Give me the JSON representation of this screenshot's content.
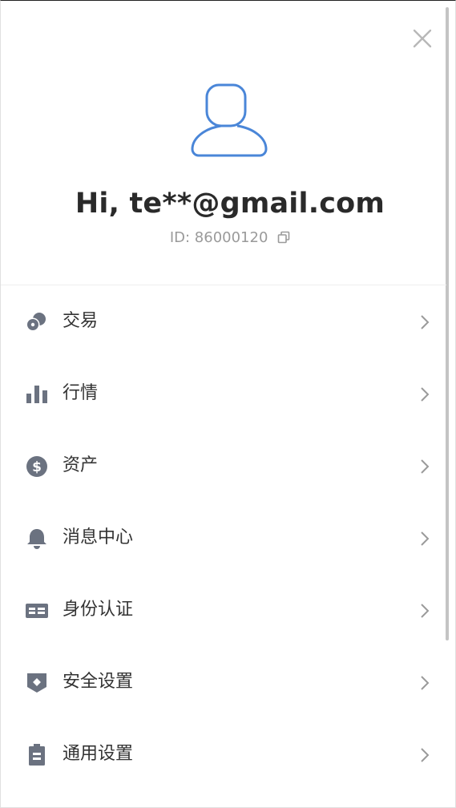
{
  "user": {
    "greeting": "Hi, te**@gmail.com",
    "id_text": "ID: 86000120"
  },
  "icons": {
    "close": "close-icon",
    "avatar": "user-avatar-icon",
    "copy": "copy-icon"
  },
  "colors": {
    "avatar_stroke": "#4a86d8",
    "icon_gray": "#6b7280",
    "chevron": "#9a9a9a",
    "text": "#333333"
  },
  "menu": {
    "items": [
      {
        "label": "交易",
        "icon": "coins-icon"
      },
      {
        "label": "行情",
        "icon": "bar-chart-icon"
      },
      {
        "label": "资产",
        "icon": "dollar-circle-icon"
      },
      {
        "label": "消息中心",
        "icon": "bell-icon"
      },
      {
        "label": "身份认证",
        "icon": "id-card-icon"
      },
      {
        "label": "安全设置",
        "icon": "shield-icon"
      },
      {
        "label": "通用设置",
        "icon": "clipboard-icon"
      }
    ]
  }
}
